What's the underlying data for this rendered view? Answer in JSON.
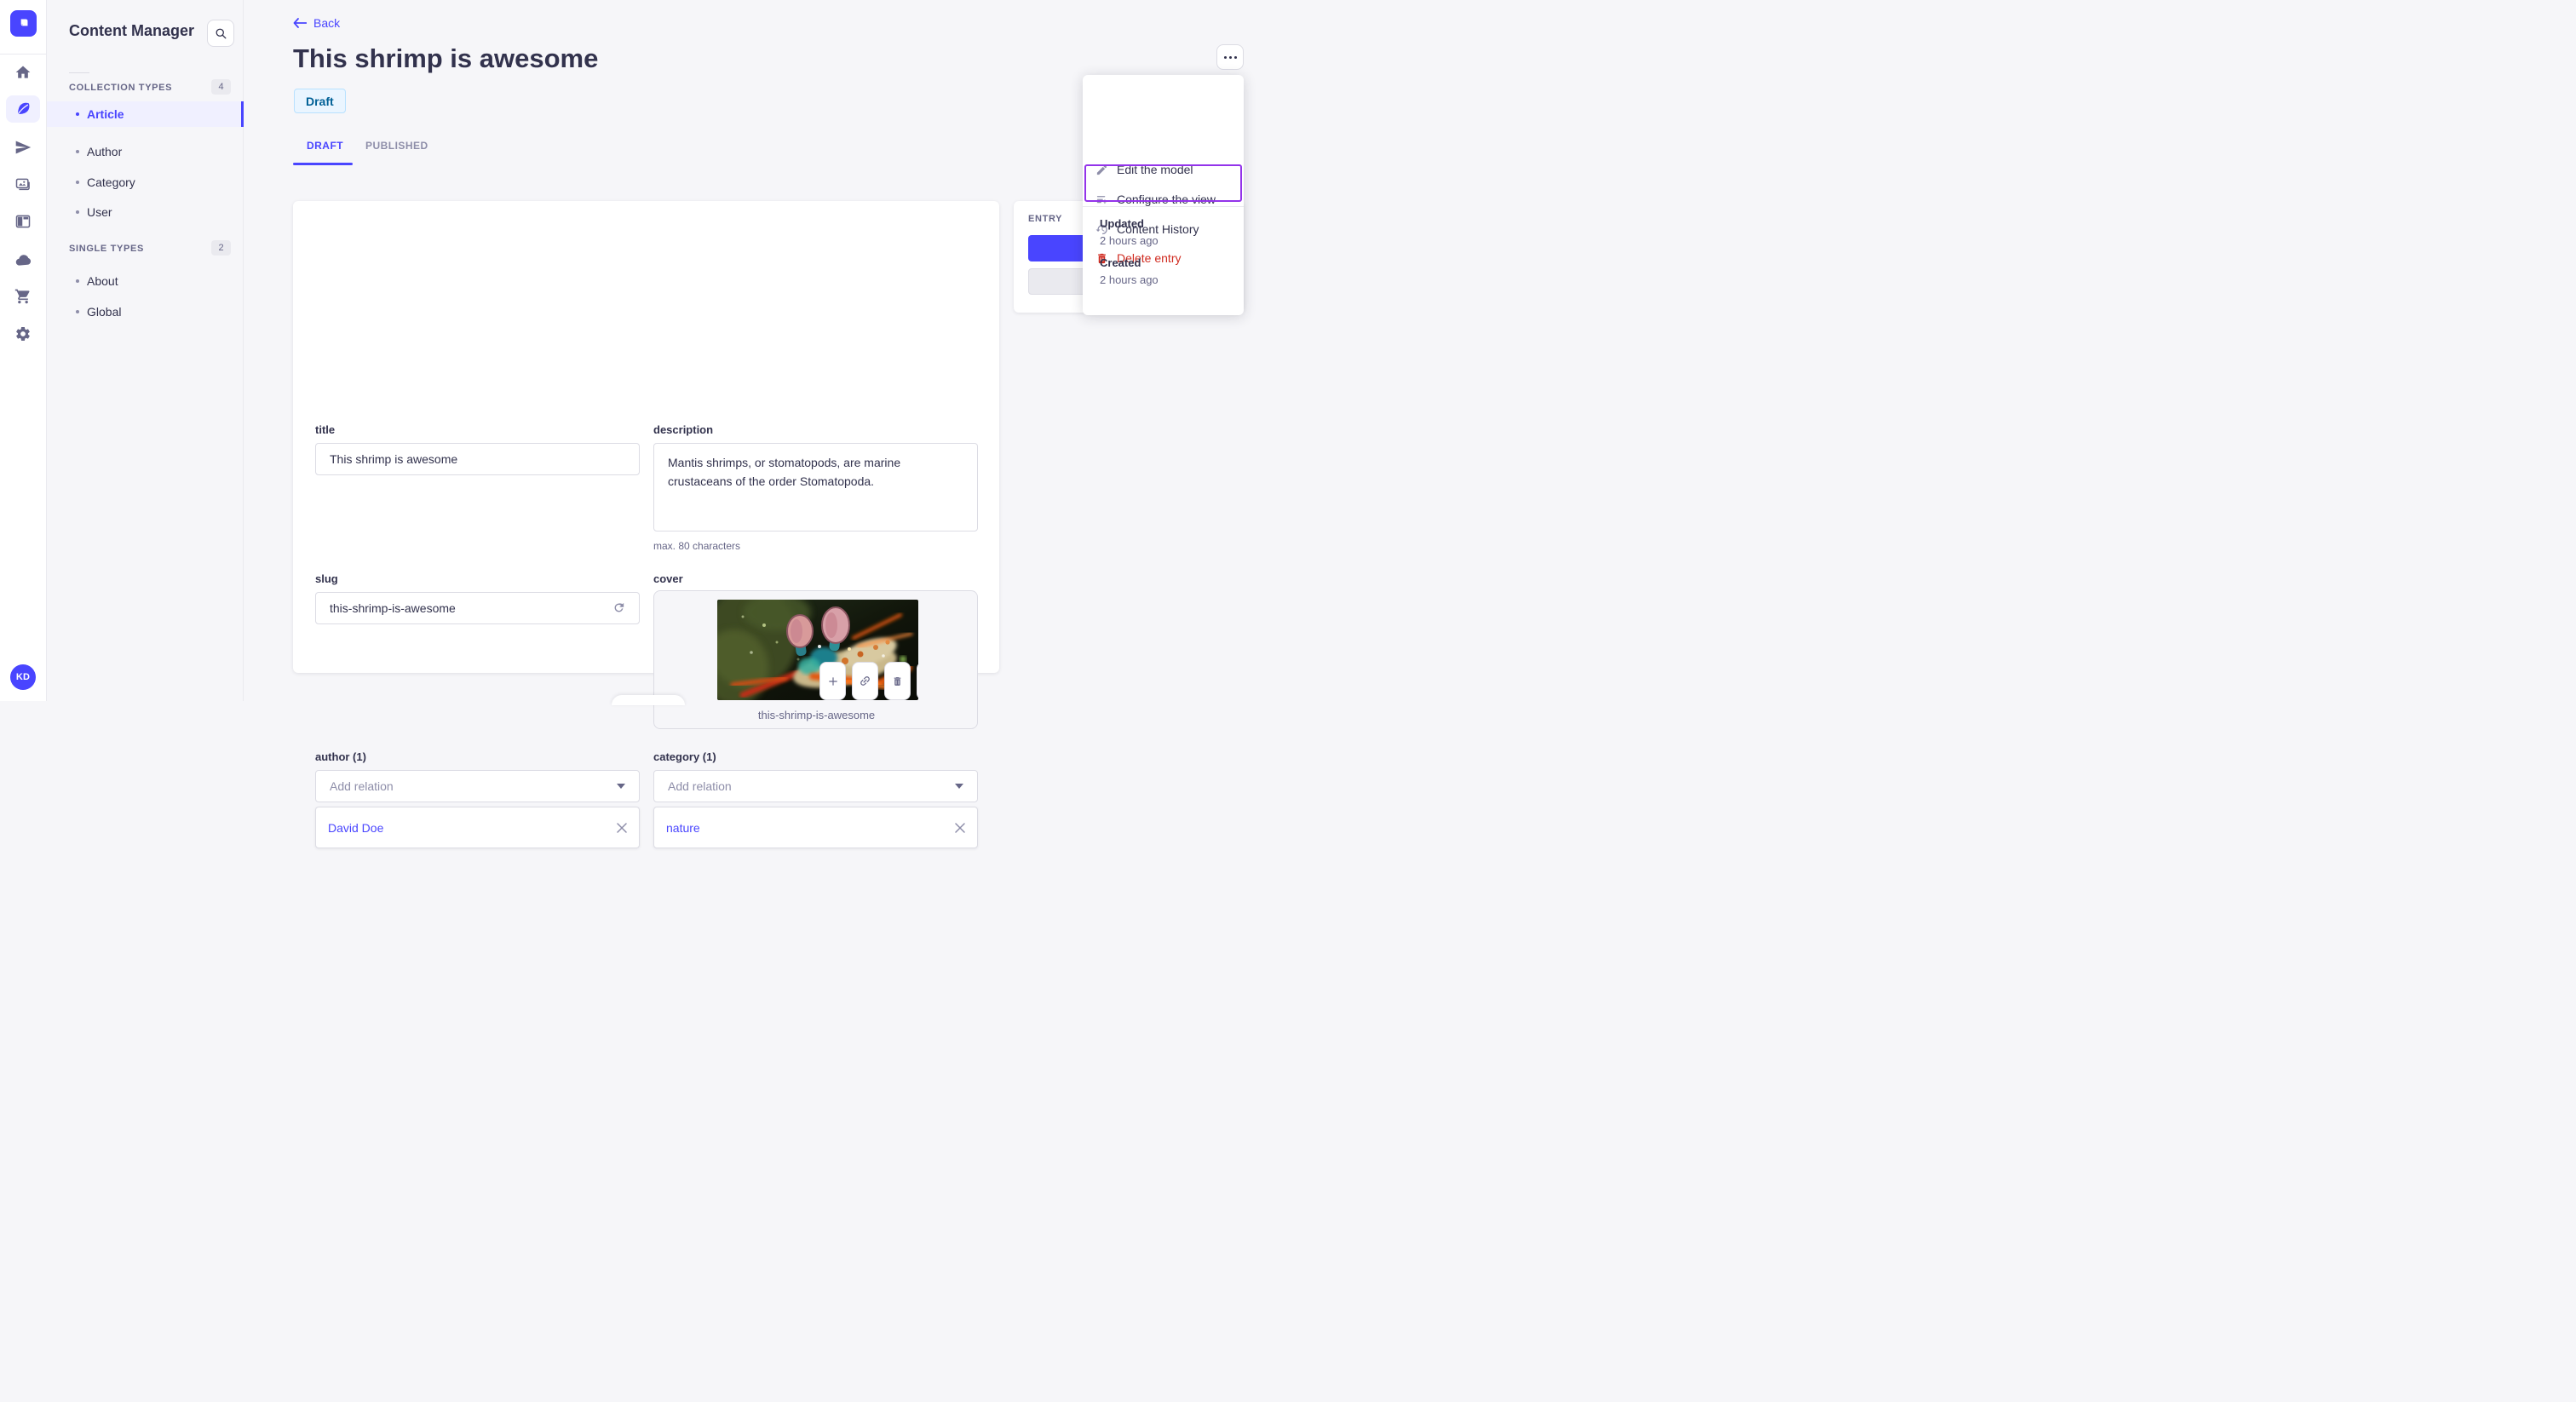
{
  "rail": {
    "icons": [
      "home-icon",
      "feather-icon",
      "paper-plane-icon",
      "media-library-icon",
      "layout-icon",
      "cloud-icon",
      "cart-icon",
      "gear-icon"
    ],
    "active_icon": "feather-icon",
    "user_initials": "KD"
  },
  "subnav": {
    "title": "Content Manager",
    "sections": [
      {
        "label": "COLLECTION TYPES",
        "count": "4",
        "items": [
          {
            "label": "Article"
          },
          {
            "label": "Author"
          },
          {
            "label": "Category"
          },
          {
            "label": "User"
          }
        ],
        "active_item": "Article"
      },
      {
        "label": "SINGLE TYPES",
        "count": "2",
        "items": [
          {
            "label": "About"
          },
          {
            "label": "Global"
          }
        ]
      }
    ]
  },
  "header": {
    "back_label": "Back",
    "title": "This shrimp is awesome",
    "status_badge": "Draft",
    "tabs": [
      {
        "label": "DRAFT",
        "active": true
      },
      {
        "label": "PUBLISHED",
        "active": false
      }
    ]
  },
  "form": {
    "title": {
      "label": "title",
      "value": "This shrimp is awesome"
    },
    "description": {
      "label": "description",
      "value": "Mantis shrimps, or stomatopods, are marine crustaceans of the order Stomatopoda.",
      "hint": "max. 80 characters"
    },
    "slug": {
      "label": "slug",
      "value": "this-shrimp-is-awesome"
    },
    "cover": {
      "label": "cover",
      "filename": "this-shrimp-is-awesome"
    },
    "author": {
      "label": "author (1)",
      "placeholder": "Add relation",
      "value": "David Doe"
    },
    "category": {
      "label": "category (1)",
      "placeholder": "Add relation",
      "value": "nature"
    }
  },
  "entry_panel": {
    "title": "ENTRY"
  },
  "menu": {
    "items": [
      {
        "label": "Edit the model",
        "icon": "pencil-icon"
      },
      {
        "label": "Configure the view",
        "icon": "configure-icon"
      },
      {
        "label": "Content History",
        "icon": "history-icon"
      },
      {
        "label": "Delete entry",
        "icon": "trash-icon",
        "danger": true,
        "highlighted": true
      }
    ],
    "meta": [
      {
        "label": "Updated",
        "value": "2 hours ago"
      },
      {
        "label": "Created",
        "value": "2 hours ago"
      }
    ]
  },
  "colors": {
    "primary": "#4945ff",
    "primary_bg": "#f0f0ff",
    "danger": "#d02b20",
    "highlight_outline": "#9333ea",
    "draft_bg": "#eaf5ff",
    "draft_border": "#b8e1ff",
    "draft_text": "#006096"
  }
}
